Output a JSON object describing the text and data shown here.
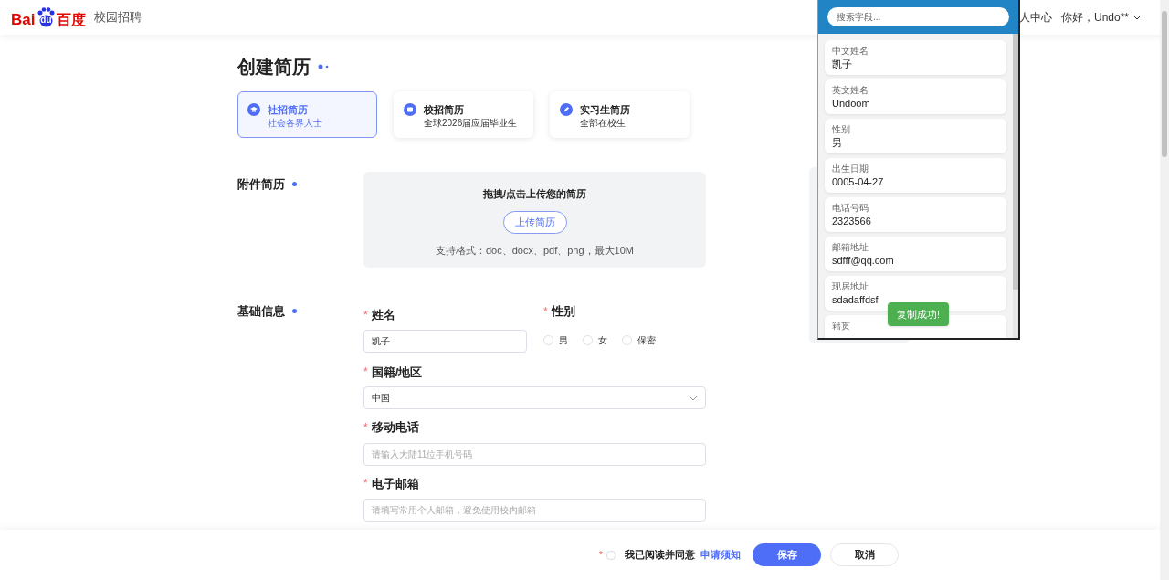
{
  "header": {
    "logo": {
      "latin": "Bai",
      "paw": "du",
      "chinese": "百度"
    },
    "subtitle": "校园招聘",
    "nav": [
      "人中心"
    ],
    "user": "你好，Undo**"
  },
  "page_title": "创建简历",
  "resume_types": [
    {
      "title": "社招简历",
      "subtitle": "社会各界人士",
      "selected": true
    },
    {
      "title": "校招简历",
      "subtitle": "全球2026届应届毕业生",
      "selected": false
    },
    {
      "title": "实习生简历",
      "subtitle": "全部在校生",
      "selected": false
    }
  ],
  "attachment": {
    "label": "附件简历",
    "hint": "拖拽/点击上传您的简历",
    "button": "上传简历",
    "formats": "支持格式：doc、docx、pdf、png，最大10M"
  },
  "basic_info": {
    "label": "基础信息",
    "name": {
      "label": "姓名",
      "required": true,
      "value": "凯子"
    },
    "gender": {
      "label": "性别",
      "required": true,
      "options": [
        {
          "label": "男",
          "selected": false
        },
        {
          "label": "女",
          "selected": false
        },
        {
          "label": "保密",
          "selected": false
        }
      ]
    },
    "nationality": {
      "label": "国籍/地区",
      "required": true,
      "value": "中国"
    },
    "phone": {
      "label": "移动电话",
      "required": true,
      "placeholder": "请输入大陆11位手机号码"
    },
    "email": {
      "label": "电子邮箱",
      "required": true,
      "placeholder": "请填写常用个人邮箱，避免使用校内邮箱"
    }
  },
  "required_mark": "*",
  "footer": {
    "required": true,
    "agree_checked": false,
    "agree_text": "我已阅读并同意",
    "agree_link": "申请须知",
    "save": "保存",
    "cancel": "取消"
  },
  "field_panel": {
    "search_placeholder": "搜索字段...",
    "fields": [
      {
        "label": "中文姓名",
        "value": "凯子"
      },
      {
        "label": "英文姓名",
        "value": "Undoom"
      },
      {
        "label": "性别",
        "value": "男"
      },
      {
        "label": "出生日期",
        "value": "0005-04-27"
      },
      {
        "label": "电话号码",
        "value": "2323566"
      },
      {
        "label": "邮箱地址",
        "value": "sdfff@qq.com"
      },
      {
        "label": "现居地址",
        "value": "sdadaffdsf"
      },
      {
        "label": "籍贯"
      }
    ],
    "toast": "复制成功!"
  }
}
